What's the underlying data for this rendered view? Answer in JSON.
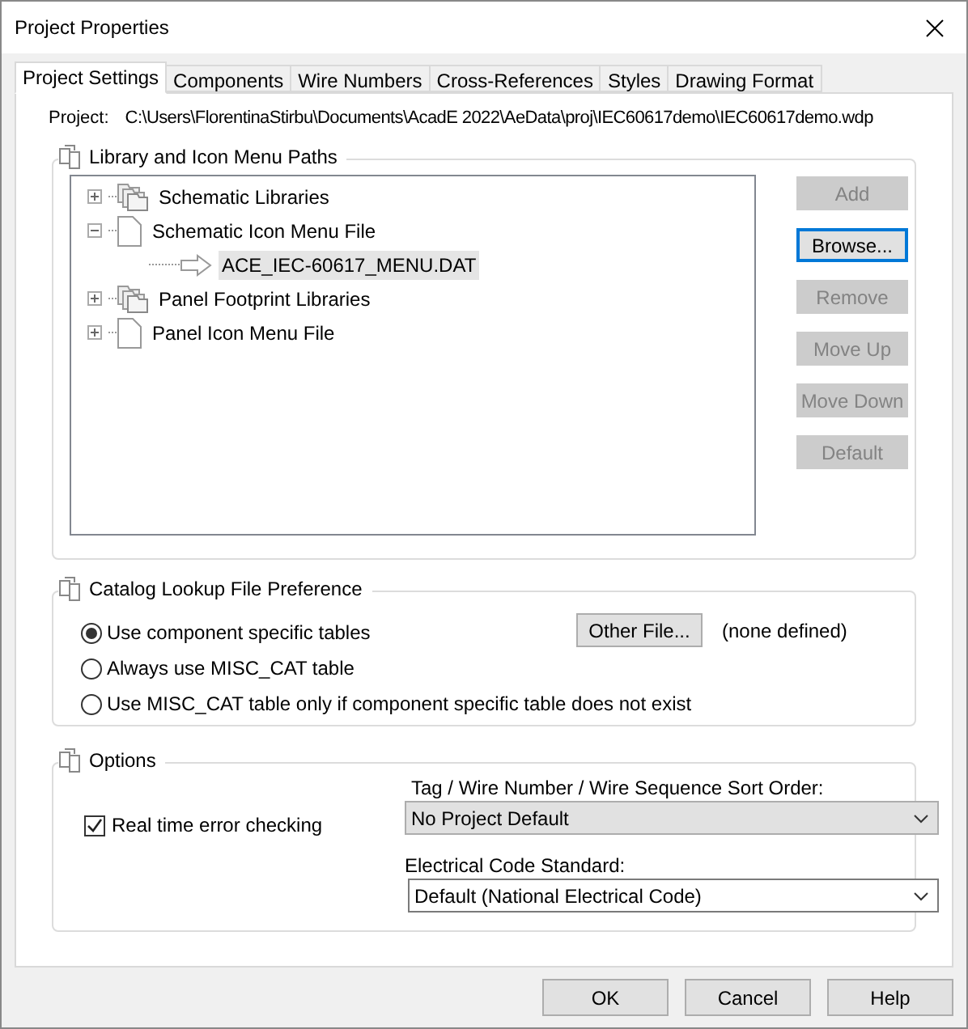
{
  "window": {
    "title": "Project Properties"
  },
  "tabs": [
    {
      "label": "Project Settings",
      "selected": true
    },
    {
      "label": "Components",
      "selected": false
    },
    {
      "label": "Wire Numbers",
      "selected": false
    },
    {
      "label": "Cross-References",
      "selected": false
    },
    {
      "label": "Styles",
      "selected": false
    },
    {
      "label": "Drawing Format",
      "selected": false
    }
  ],
  "project": {
    "label": "Project:",
    "path": "C:\\Users\\FlorentinaStirbu\\Documents\\AcadE 2022\\AeData\\proj\\IEC60617demo\\IEC60617demo.wdp"
  },
  "library_paths": {
    "title": "Library and Icon Menu Paths",
    "tree": [
      {
        "label": "Schematic Libraries",
        "kind": "folder",
        "expanded": false,
        "selected": false
      },
      {
        "label": "Schematic Icon Menu File",
        "kind": "file",
        "expanded": true,
        "selected": false,
        "children": [
          {
            "label": "ACE_IEC-60617_MENU.DAT",
            "kind": "arrow",
            "selected": true
          }
        ]
      },
      {
        "label": "Panel Footprint Libraries",
        "kind": "folder",
        "expanded": false,
        "selected": false
      },
      {
        "label": "Panel Icon Menu File",
        "kind": "file",
        "expanded": false,
        "selected": false
      }
    ],
    "buttons": [
      {
        "label": "Add",
        "disabled": true,
        "focused": false
      },
      {
        "label": "Browse...",
        "disabled": false,
        "focused": true
      },
      {
        "label": "Remove",
        "disabled": true,
        "focused": false
      },
      {
        "label": "Move Up",
        "disabled": true,
        "focused": false
      },
      {
        "label": "Move Down",
        "disabled": true,
        "focused": false
      },
      {
        "label": "Default",
        "disabled": true,
        "focused": false
      }
    ]
  },
  "catalog_lookup": {
    "title": "Catalog Lookup File Preference",
    "options": [
      {
        "label": "Use component specific tables",
        "selected": true
      },
      {
        "label": "Always use MISC_CAT table",
        "selected": false
      },
      {
        "label": "Use MISC_CAT table only if component specific table does not exist",
        "selected": false
      }
    ],
    "other_file_button": "Other File...",
    "other_file_value": "(none defined)"
  },
  "options": {
    "title": "Options",
    "realtime_check": {
      "label": "Real time error checking",
      "checked": true
    },
    "sort_order": {
      "label": "Tag / Wire Number / Wire Sequence Sort Order:",
      "value": "No Project Default",
      "disabled": true
    },
    "code_standard": {
      "label": "Electrical Code Standard:",
      "value": "Default (National Electrical Code)",
      "disabled": false
    }
  },
  "footer_buttons": [
    "OK",
    "Cancel",
    "Help"
  ]
}
